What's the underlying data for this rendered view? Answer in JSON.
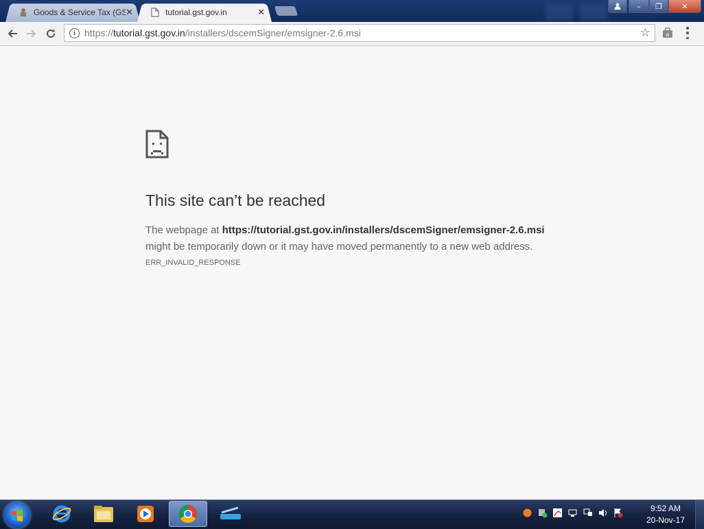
{
  "browser": {
    "tabs": [
      {
        "title": "Goods & Service Tax (GS",
        "active": false,
        "icon": "emblem-favicon"
      },
      {
        "title": "tutorial.gst.gov.in",
        "active": true,
        "icon": "page-icon"
      }
    ],
    "tab_close_glyph": "✕",
    "window_controls": {
      "minimize": "–",
      "maximize": "❐",
      "close": "✕"
    },
    "address": {
      "scheme": "https://",
      "host": "tutorial.gst.gov.in",
      "path": "/installers/dscemSigner/emsigner-2.6.msi"
    }
  },
  "error_page": {
    "title": "This site can’t be reached",
    "body_prefix": "The webpage at ",
    "url": "https://tutorial.gst.gov.in/installers/dscemSigner/emsigner-2.6.msi",
    "body_suffix": " might be temporarily down or it may have moved permanently to a new web address.",
    "error_code": "ERR_INVALID_RESPONSE"
  },
  "taskbar": {
    "pinned": [
      "internet-explorer-icon",
      "file-explorer-icon",
      "media-player-icon",
      "chrome-icon",
      "scanner-app-icon"
    ],
    "active_item": "chrome-icon",
    "clock": {
      "time": "9:52 AM",
      "date": "20-Nov-17"
    }
  },
  "colors": {
    "page_bg": "#f7f7f7",
    "tabstrip": "#1c3c74",
    "taskbar": "#152241",
    "title_text": "#333333"
  }
}
